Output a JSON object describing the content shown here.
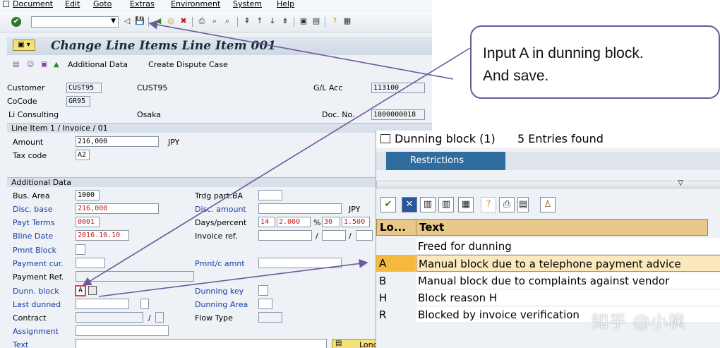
{
  "menu": [
    "Document",
    "Edit",
    "Goto",
    "Extras",
    "Environment",
    "System",
    "Help"
  ],
  "screen_title": "Change Line Items Line Item 001",
  "app_toolbar": {
    "additional_data": "Additional Data",
    "create_dispute": "Create Dispute Case"
  },
  "header": {
    "customer_label": "Customer",
    "customer_value": "CUST95",
    "customer_name": "CUST95",
    "cocode_label": "CoCode",
    "cocode_value": "GR95",
    "company_name": "Li Consulting",
    "city": "Osaka",
    "gl_label": "G/L Acc",
    "gl_value": "113100",
    "docno_label": "Doc. No.",
    "docno_value": "1800000018"
  },
  "line_item": {
    "section": "Line Item 1 / Invoice / 01",
    "amount_label": "Amount",
    "amount_value": "216,000",
    "currency": "JPY",
    "tax_label": "Tax code",
    "tax_value": "A2"
  },
  "additional": {
    "section": "Additional Data",
    "bus_area_label": "Bus. Area",
    "bus_area_value": "1000",
    "disc_base_label": "Disc. base",
    "disc_base_value": "216,000",
    "payt_terms_label": "Payt Terms",
    "payt_terms_value": "0001",
    "bline_label": "Bline Date",
    "bline_value": "2016.10.10",
    "pmnt_block_label": "Pmnt Block",
    "payment_cur_label": "Payment cur.",
    "payment_ref_label": "Payment Ref.",
    "dunn_block_label": "Dunn. block",
    "dunn_block_value": "A",
    "last_dunned_label": "Last dunned",
    "contract_label": "Contract",
    "contract_sep": "/",
    "assignment_label": "Assignment",
    "text_label": "Text",
    "trdg_label": "Trdg part.BA",
    "disc_amount_label": "Disc. amount",
    "disc_amount_cur": "JPY",
    "days_label": "Days/percent",
    "days1": "14",
    "pct1": "2.000",
    "pct_sign": "%",
    "days2": "30",
    "pct2": "1.500",
    "invoice_ref_label": "Invoice ref.",
    "slash": "/",
    "pmnt_amnt_label": "Pmnt/c amnt",
    "dunning_key_label": "Dunning key",
    "dunning_area_label": "Dunning Area",
    "flow_type_label": "Flow Type",
    "long_text": "Long text"
  },
  "callout": {
    "line1": "Input A in dunning block.",
    "line2": "And save."
  },
  "popup": {
    "title": "Dunning block (1)",
    "count": "5 Entries found",
    "tab": "Restrictions",
    "col1": "Lo...",
    "col2": "Text",
    "rows": [
      {
        "code": "",
        "text": "Freed for dunning"
      },
      {
        "code": "A",
        "text": "Manual block due to a telephone payment advice"
      },
      {
        "code": "B",
        "text": "Manual block due to complaints against vendor"
      },
      {
        "code": "H",
        "text": "Block reason H"
      },
      {
        "code": "R",
        "text": "Blocked by invoice verification"
      }
    ]
  },
  "watermark": "知乎 @小枫",
  "colors": {
    "arrow": "#6a5a9a",
    "selected_row": "#fbe9bd",
    "tab_blue": "#2f6d9f",
    "label_blue": "#1a3aa8",
    "required_red": "#c01818"
  }
}
